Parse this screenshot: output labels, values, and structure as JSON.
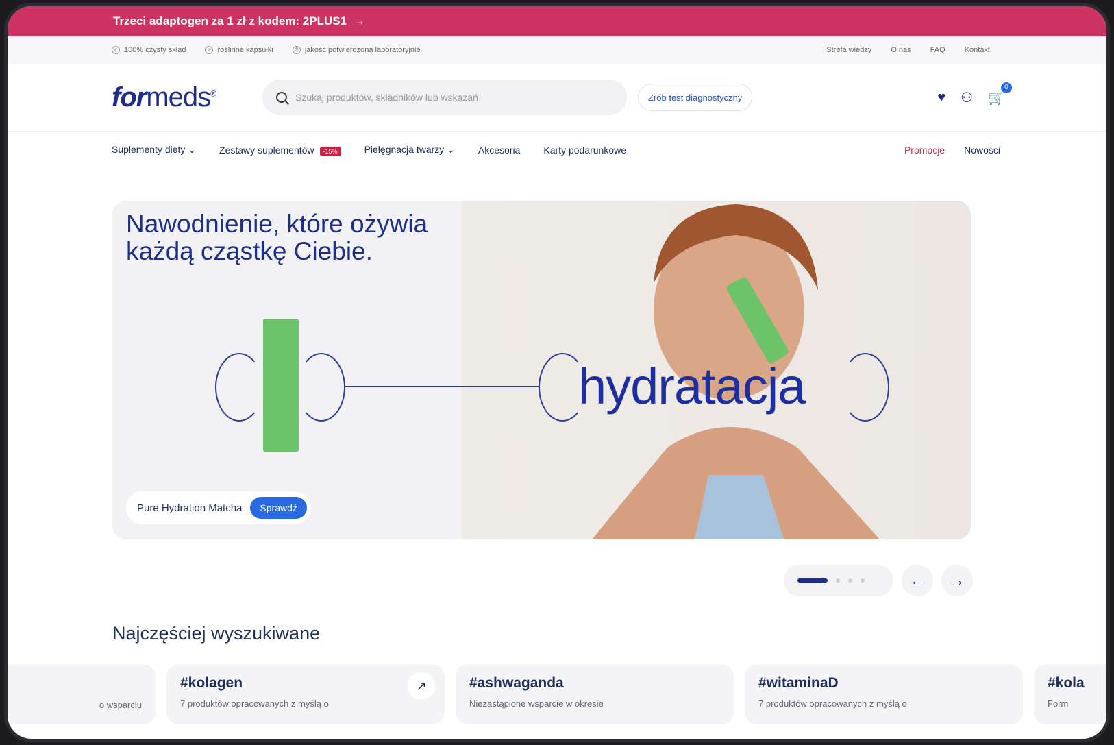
{
  "promo": {
    "text": "Trzeci adaptogen za 1 zł z kodem: 2PLUS1",
    "arrow": "→"
  },
  "utility": {
    "left": [
      {
        "icon": "leaf-icon",
        "text": "100% czysty skład"
      },
      {
        "icon": "capsule-icon",
        "text": "roślinne kapsułki"
      },
      {
        "icon": "lab-icon",
        "text": "jakość potwierdzona laboratoryjnie"
      }
    ],
    "right": [
      "Strefa wiedzy",
      "O nas",
      "FAQ",
      "Kontakt"
    ]
  },
  "header": {
    "logo_bold": "for",
    "logo_rest": "meds",
    "logo_mark": "®",
    "search_placeholder": "Szukaj produktów, składników lub wskazań",
    "diag_button": "Zrób test diagnostyczny",
    "cart_count": "0"
  },
  "nav": {
    "items": [
      {
        "label": "Suplementy diety",
        "caret": "⌄"
      },
      {
        "label": "Zestawy suplementów",
        "pill": "-15%"
      },
      {
        "label": "Pielęgnacja twarzy",
        "caret": "⌄"
      },
      {
        "label": "Akcesoria"
      },
      {
        "label": "Karty podarunkowe"
      }
    ],
    "right": [
      {
        "label": "Promocje"
      },
      {
        "label": "Nowości"
      }
    ]
  },
  "hero": {
    "headline": "Nawodnienie, które ożywia każdą cząstkę Ciebie.",
    "word": "hydratacja",
    "product": "Pure Hydration Matcha",
    "cta": "Sprawdź"
  },
  "carousel": {
    "prev": "←",
    "next": "→"
  },
  "section": {
    "title": "Najczęściej wyszukiwane"
  },
  "tags": [
    {
      "title": "",
      "desc": "o wsparciu"
    },
    {
      "title": "#kolagen",
      "desc": "7 produktów opracowanych z myślą o"
    },
    {
      "title": "#ashwaganda",
      "desc": "Niezastąpione wsparcie w okresie"
    },
    {
      "title": "#witaminaD",
      "desc": "7 produktów opracowanych z myślą o"
    },
    {
      "title": "#kola",
      "desc": "Form"
    }
  ],
  "colors": {
    "brand": "#1d2f8a",
    "promo": "#cc3362",
    "accent": "#2a6ae0"
  }
}
